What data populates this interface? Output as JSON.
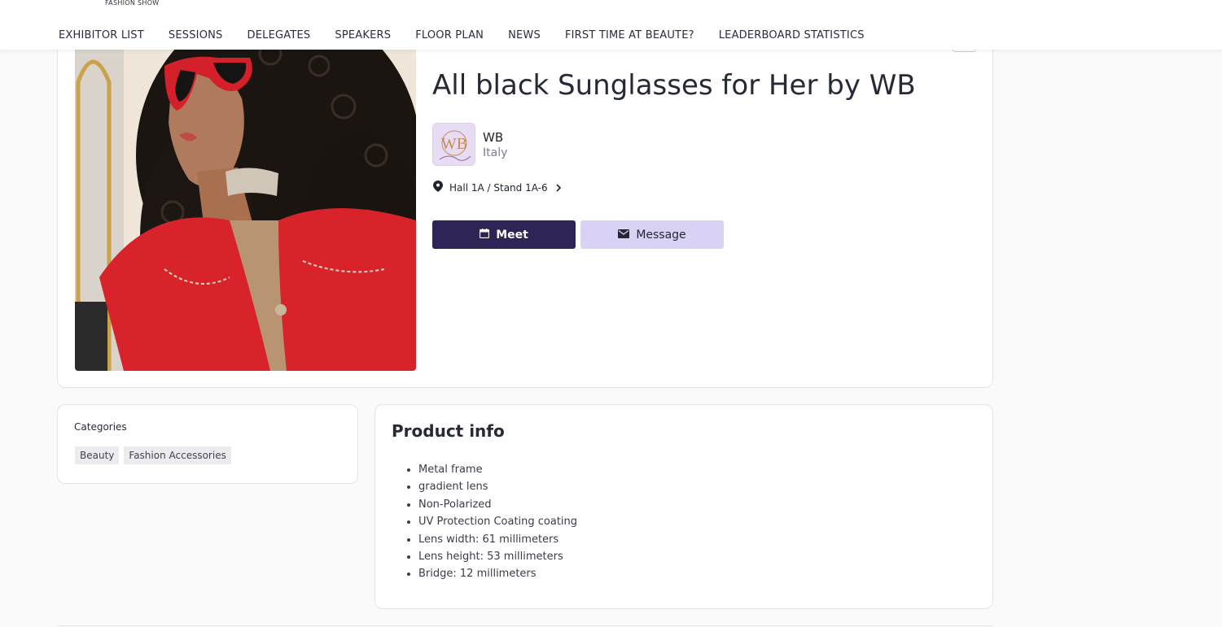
{
  "header": {
    "brand_subtitle": "FASHION SHOW",
    "nav": [
      {
        "label": "EXHIBITOR LIST"
      },
      {
        "label": "SESSIONS"
      },
      {
        "label": "DELEGATES"
      },
      {
        "label": "SPEAKERS"
      },
      {
        "label": "FLOOR PLAN"
      },
      {
        "label": "NEWS"
      },
      {
        "label": "FIRST TIME AT BEAUTE?"
      },
      {
        "label": "LEADERBOARD STATISTICS"
      }
    ]
  },
  "product": {
    "title": "All black Sunglasses for Her by WB",
    "company": {
      "name": "WB",
      "country": "Italy",
      "logo_letters": "WB"
    },
    "stand": "Hall 1A / Stand 1A-6",
    "actions": {
      "meet_label": "Meet",
      "message_label": "Message"
    }
  },
  "categories": {
    "title": "Categories",
    "items": [
      "Beauty",
      "Fashion Accessories"
    ]
  },
  "product_info": {
    "title": "Product info",
    "items": [
      "Metal frame",
      "gradient lens",
      "Non-Polarized",
      "UV Protection Coating coating",
      "Lens width: 61 millimeters",
      "Lens height: 53 millimeters",
      "Bridge: 12 millimeters"
    ]
  },
  "colors": {
    "primary": "#2e2556",
    "secondary": "#d9d2f5",
    "jacket_red": "#d8232a"
  },
  "icons": {
    "stand": "location-pin-icon",
    "stand_chevron": "chevron-right-icon",
    "meet": "calendar-icon",
    "message": "mail-icon"
  }
}
